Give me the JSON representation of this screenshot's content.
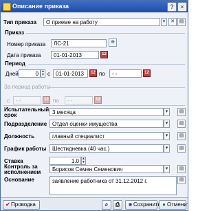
{
  "window": {
    "title": "Описание приказа",
    "close_glyph": "×"
  },
  "order_type": {
    "label": "Тип приказа",
    "value": "О приеме на работу"
  },
  "order": {
    "section": "Приказ",
    "number_label": "Номер приказа",
    "number_value": "ЛС-21",
    "date_label": "Дата приказа",
    "date_value": "01-01-2013"
  },
  "period": {
    "section": "Период",
    "days_label": "Дней",
    "days_value": "0",
    "from_label": "с",
    "from_value": "01-01-2013",
    "to_label": "по",
    "to_value": "- -"
  },
  "work_period": {
    "section": "За период работы",
    "from_label": "с",
    "from_value": "- -",
    "to_label": "по",
    "to_value": "- -"
  },
  "probation": {
    "label": "Испытательный срок",
    "value": "3 месяца"
  },
  "department": {
    "label": "Подразделение",
    "value": "Отдел оценки имущества"
  },
  "position": {
    "label": "Должность",
    "value": "главный специалист"
  },
  "schedule": {
    "label": "График работы",
    "value": "Шестидневка (40 час.)"
  },
  "rate": {
    "label": "Ставка",
    "value": "1.0"
  },
  "control": {
    "label": "Контроль за исполнением",
    "value": "Борисов Семен Семенович"
  },
  "basis": {
    "label": "Основание",
    "value": "заявление работника от 31.12.2012 г."
  },
  "buttons": {
    "post": "Проводка",
    "save": "Сохранить",
    "cancel": "Отменить"
  },
  "colors": {
    "titlebar": "#2a5bb8",
    "background": "#eef2f8",
    "calendar": "#c24040"
  }
}
